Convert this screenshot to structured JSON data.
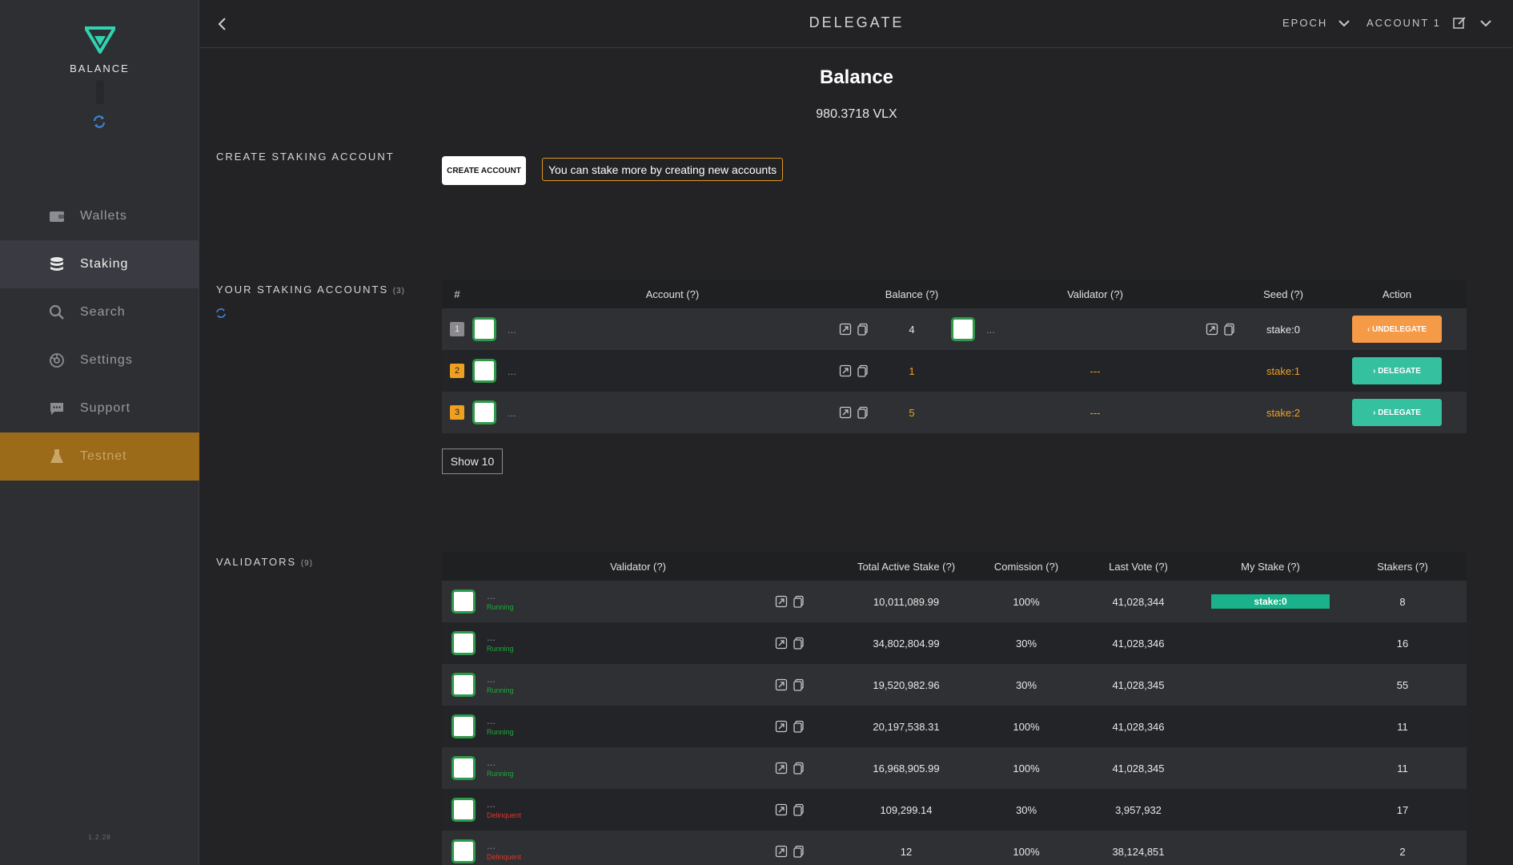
{
  "sidebar": {
    "balance_label": "BALANCE",
    "version": "1.2.28",
    "items": [
      {
        "label": "Wallets",
        "icon": "wallet-icon"
      },
      {
        "label": "Staking",
        "icon": "database-icon"
      },
      {
        "label": "Search",
        "icon": "search-icon"
      },
      {
        "label": "Settings",
        "icon": "settings-icon"
      },
      {
        "label": "Support",
        "icon": "chat-icon"
      },
      {
        "label": "Testnet",
        "icon": "flask-icon"
      }
    ]
  },
  "header": {
    "title": "DELEGATE",
    "epoch": "EPOCH",
    "account": "ACCOUNT 1"
  },
  "balance": {
    "title": "Balance",
    "value": "980.3718 VLX"
  },
  "create": {
    "section_label": "CREATE STAKING ACCOUNT",
    "button": "CREATE ACCOUNT",
    "hint": "You can stake more by creating new accounts"
  },
  "staking": {
    "section_label": "YOUR STAKING ACCOUNTS",
    "count": "(3)",
    "headers": [
      "#",
      "Account (?)",
      "Balance (?)",
      "Validator (?)",
      "Seed (?)",
      "Action"
    ],
    "rows": [
      {
        "index": "1",
        "account": "...",
        "balance": "4",
        "validator": "...",
        "seed": "stake:0",
        "action": "UNDELEGATE"
      },
      {
        "index": "2",
        "account": "...",
        "balance": "1",
        "validator": "---",
        "seed": "stake:1",
        "action": "DELEGATE"
      },
      {
        "index": "3",
        "account": "...",
        "balance": "5",
        "validator": "---",
        "seed": "stake:2",
        "action": "DELEGATE"
      }
    ],
    "show_button": "Show 10"
  },
  "validators": {
    "section_label": "VALIDATORS",
    "count": "(9)",
    "headers": [
      "Validator (?)",
      "Total Active Stake (?)",
      "Comission (?)",
      "Last Vote (?)",
      "My Stake (?)",
      "Stakers (?)"
    ],
    "rows": [
      {
        "name": "...",
        "status": "Running",
        "stake": "10,011,089.99",
        "commission": "100%",
        "last_vote": "41,028,344",
        "my_stake": "stake:0",
        "stakers": "8"
      },
      {
        "name": "...",
        "status": "Running",
        "stake": "34,802,804.99",
        "commission": "30%",
        "last_vote": "41,028,346",
        "my_stake": "",
        "stakers": "16"
      },
      {
        "name": "...",
        "status": "Running",
        "stake": "19,520,982.96",
        "commission": "30%",
        "last_vote": "41,028,345",
        "my_stake": "",
        "stakers": "55"
      },
      {
        "name": "...",
        "status": "Running",
        "stake": "20,197,538.31",
        "commission": "100%",
        "last_vote": "41,028,346",
        "my_stake": "",
        "stakers": "11"
      },
      {
        "name": "...",
        "status": "Running",
        "stake": "16,968,905.99",
        "commission": "100%",
        "last_vote": "41,028,345",
        "my_stake": "",
        "stakers": "11"
      },
      {
        "name": "...",
        "status": "Delinquent",
        "stake": "109,299.14",
        "commission": "30%",
        "last_vote": "3,957,932",
        "my_stake": "",
        "stakers": "17"
      },
      {
        "name": "...",
        "status": "Delinquent",
        "stake": "12",
        "commission": "100%",
        "last_vote": "38,124,851",
        "my_stake": "",
        "stakers": "2"
      }
    ]
  },
  "colors": {
    "accent_green": "#35c0a0",
    "accent_orange": "#f59a46",
    "running": "#1fa83a",
    "delinquent": "#d9372c"
  }
}
